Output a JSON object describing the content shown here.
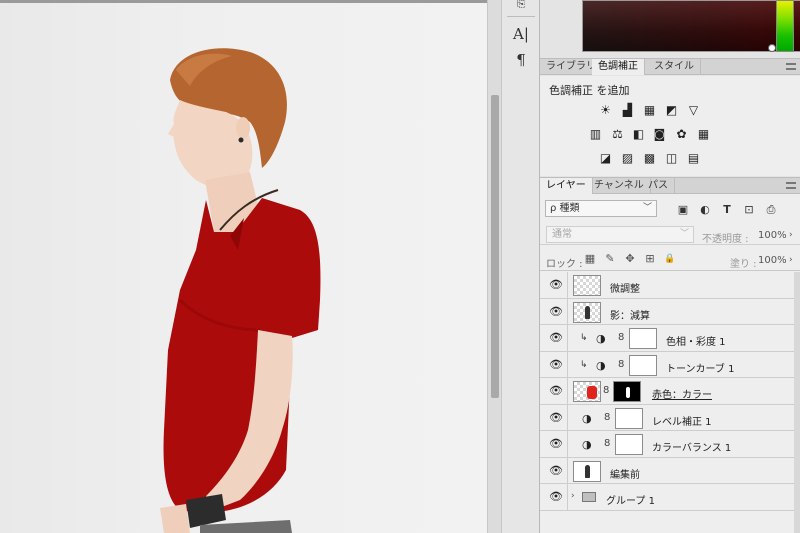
{
  "tools": {
    "type_tool_glyph": "A|",
    "paragraph_glyph": "¶"
  },
  "color_picker": {
    "hue_strip_top": "#e8f000",
    "hue_strip_bottom": "#00a800",
    "field_color": "#120505"
  },
  "adjust_panel": {
    "tabs": [
      {
        "label": "ライブラリ",
        "active": false
      },
      {
        "label": "色調補正",
        "active": true
      },
      {
        "label": "スタイル",
        "active": false
      }
    ],
    "title": "色調補正 を追加",
    "icon_rows": [
      [
        "brightness-contrast-icon",
        "levels-icon",
        "curves-icon",
        "exposure-icon",
        "vibrance-icon"
      ],
      [
        "hue-saturation-icon",
        "color-balance-icon",
        "black-white-icon",
        "photo-filter-icon",
        "channel-mixer-icon",
        "color-lookup-icon"
      ],
      [
        "invert-icon",
        "posterize-icon",
        "threshold-icon",
        "selective-color-icon",
        "gradient-map-icon"
      ]
    ],
    "icon_glyphs": [
      [
        "☀",
        "▟",
        "▦",
        "◩",
        "▽"
      ],
      [
        "▥",
        "⚖",
        "◧",
        "◙",
        "✿",
        "▦"
      ],
      [
        "◪",
        "▨",
        "▩",
        "◫",
        "▤"
      ]
    ]
  },
  "layers_panel": {
    "tabs": [
      {
        "label": "レイヤー",
        "active": true
      },
      {
        "label": "チャンネル",
        "active": false
      },
      {
        "label": "パス",
        "active": false
      }
    ],
    "filter_label": "ρ 種類",
    "filter_icons": [
      "▣",
      "◐",
      "T",
      "⊡",
      "⎙"
    ],
    "blend_mode": "通常",
    "opacity_label": "不透明度 :",
    "opacity_value": "100%",
    "lock_label": "ロック :",
    "lock_icons": [
      "▦",
      "✎",
      "✥",
      "⊞",
      "🔒"
    ],
    "fill_label": "塗り :",
    "fill_value": "100%",
    "layers": [
      {
        "name": "微調整",
        "kind": "pixel",
        "clipped": false
      },
      {
        "name": "影：減算",
        "kind": "pixel-figure",
        "clipped": false
      },
      {
        "name": "色相・彩度 1",
        "kind": "adjustment",
        "clipped": true
      },
      {
        "name": "トーンカーブ 1",
        "kind": "adjustment",
        "clipped": true
      },
      {
        "name": "赤色：カラー",
        "kind": "pixel-mask",
        "clipped": false
      },
      {
        "name": "レベル補正 1",
        "kind": "adjustment",
        "clipped": false
      },
      {
        "name": "カラーバランス 1",
        "kind": "adjustment",
        "clipped": false
      },
      {
        "name": "編集前",
        "kind": "photo",
        "clipped": false
      },
      {
        "name": "グループ 1",
        "kind": "group",
        "clipped": false
      }
    ]
  }
}
